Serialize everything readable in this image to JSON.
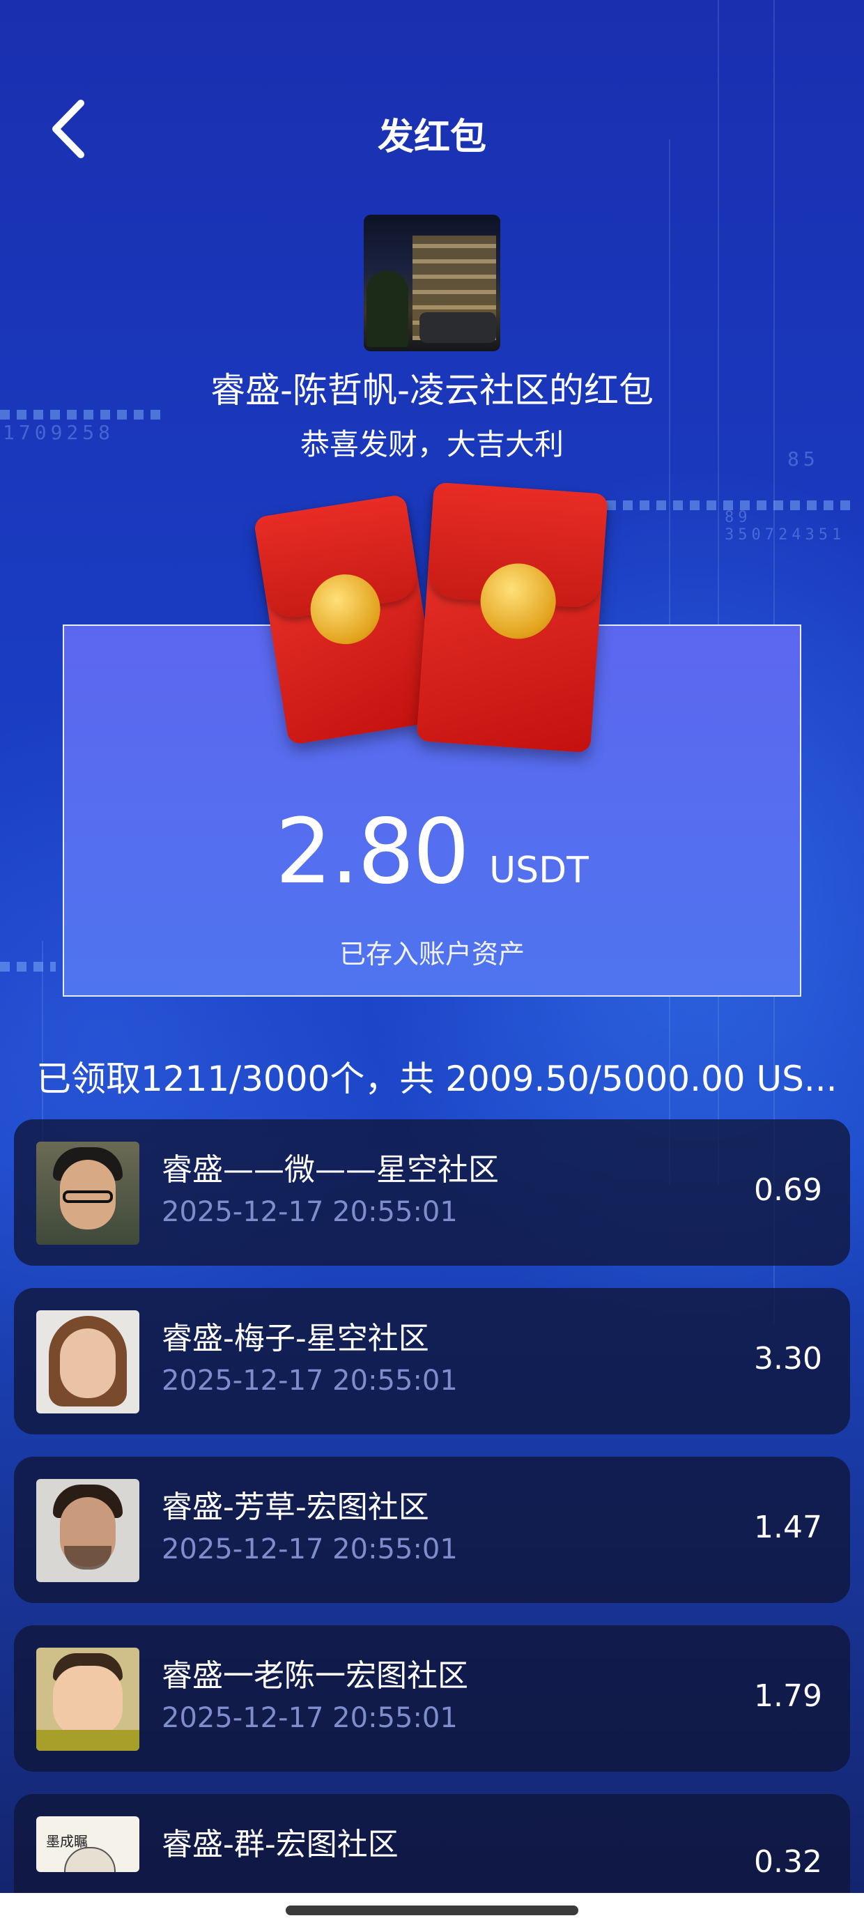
{
  "header": {
    "title": "发红包"
  },
  "packet": {
    "sender": "睿盛-陈哲帆-凌云社区的红包",
    "greeting": "恭喜发财，大吉大利",
    "amount": "2.80",
    "unit": "USDT",
    "stored_note": "已存入账户资产"
  },
  "summary": "已领取1211/3000个，共 2009.50/5000.00 US...",
  "records": [
    {
      "name": "睿盛——微——星空社区",
      "time": "2025-12-17 20:55:01",
      "amount": "0.69"
    },
    {
      "name": "睿盛-梅子-星空社区",
      "time": "2025-12-17 20:55:01",
      "amount": "3.30"
    },
    {
      "name": "睿盛-芳草-宏图社区",
      "time": "2025-12-17 20:55:01",
      "amount": "1.47"
    },
    {
      "name": "睿盛一老陈一宏图社区",
      "time": "2025-12-17 20:55:01",
      "amount": "1.79"
    },
    {
      "name": "睿盛-群-宏图社区",
      "time": "",
      "amount": "0.32"
    }
  ],
  "decor": {
    "digits_left": "1709258",
    "digits_right": "85",
    "digits_right2": "89 350724351",
    "avatar5_text": "墨成瞩"
  },
  "icons": {
    "back": "chevron-left-icon"
  },
  "colors": {
    "accent": "#4f74ef",
    "envelope": "#d81e18",
    "coin": "#e2a21c"
  }
}
